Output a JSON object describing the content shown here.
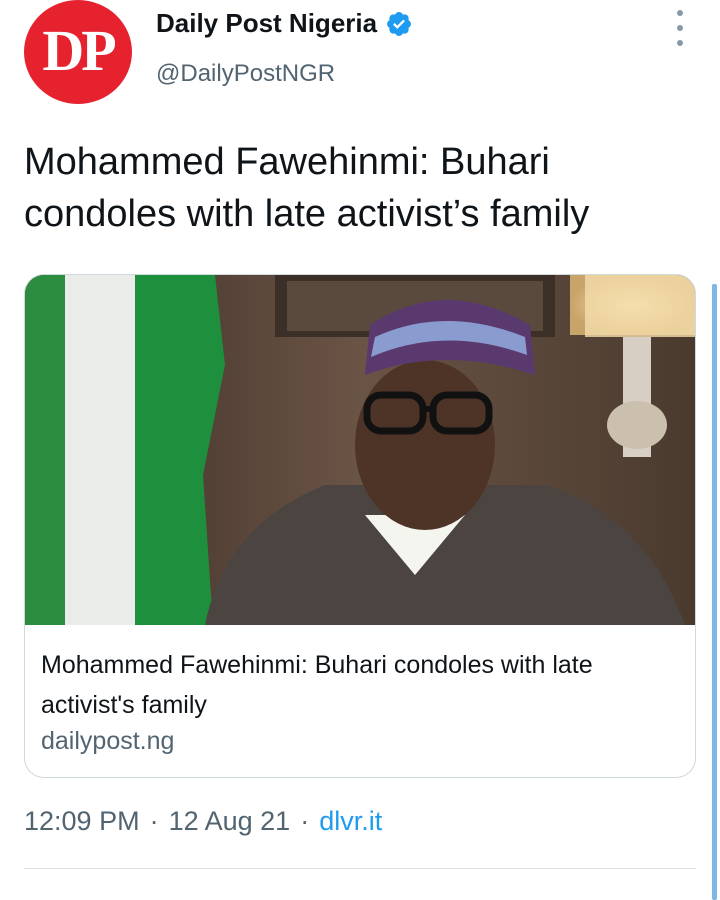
{
  "account": {
    "avatar_text": "DP",
    "display_name": "Daily Post Nigeria",
    "handle": "@DailyPostNGR",
    "verified": true
  },
  "tweet": {
    "text": "Mohammed Fawehinmi: Buhari condoles with late activist’s family"
  },
  "card": {
    "title": "Mohammed Fawehinmi: Buhari condoles with late activist's family",
    "domain": "dailypost.ng"
  },
  "meta": {
    "time": "12:09 PM",
    "separator": "·",
    "date": "12 Aug 21",
    "source": "dlvr.it"
  },
  "colors": {
    "avatar_bg": "#e6222f",
    "verified_blue": "#1d9bf0",
    "secondary_text": "#536471",
    "link_blue": "#1d9bf0"
  },
  "icons": {
    "verified": "verified-badge-icon",
    "more": "more-vertical-icon"
  }
}
